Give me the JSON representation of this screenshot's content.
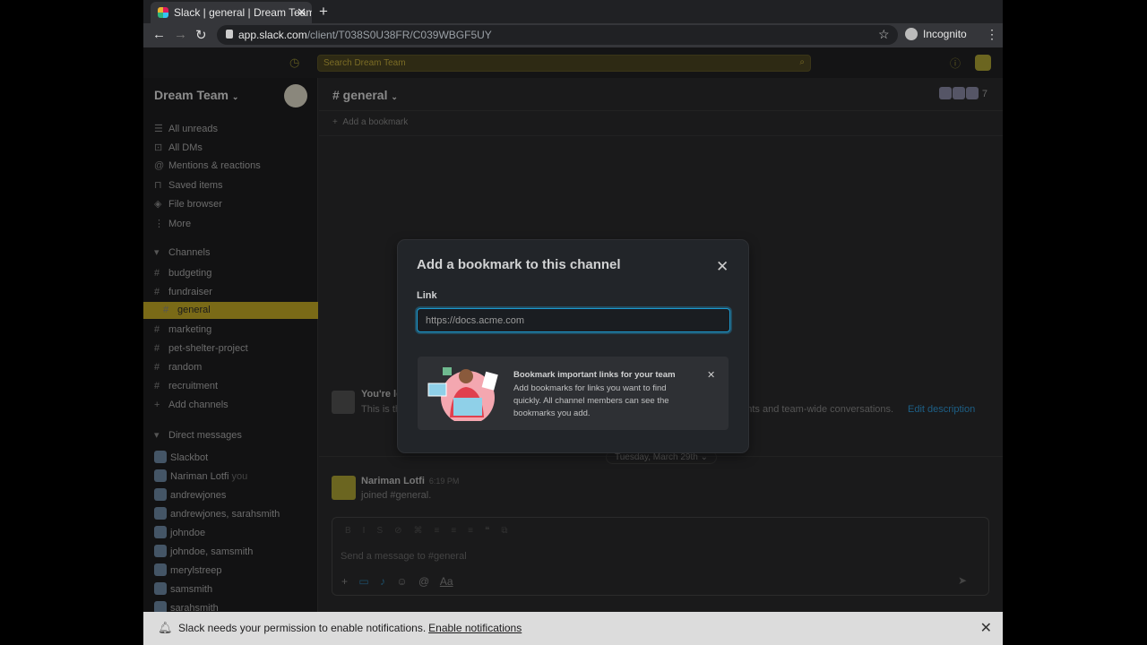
{
  "browser": {
    "tab_title": "Slack | general | Dream Team",
    "url_host": "app.slack.com",
    "url_path": "/client/T038S0U38FR/C039WBGF5UY",
    "incognito_label": "Incognito"
  },
  "search": {
    "placeholder": "Search Dream Team"
  },
  "sidebar": {
    "workspace": "Dream Team",
    "nav": [
      {
        "icon": "☰",
        "label": "All unreads"
      },
      {
        "icon": "⊡",
        "label": "All DMs"
      },
      {
        "icon": "@",
        "label": "Mentions & reactions"
      },
      {
        "icon": "⊓",
        "label": "Saved items"
      },
      {
        "icon": "◈",
        "label": "File browser"
      },
      {
        "icon": "⋮",
        "label": "More"
      }
    ],
    "channels_header": "Channels",
    "channels": [
      "budgeting",
      "fundraiser",
      "general",
      "marketing",
      "pet-shelter-project",
      "random",
      "recruitment"
    ],
    "add_channels": "Add channels",
    "dm_header": "Direct messages",
    "dms": [
      {
        "name": "Slackbot"
      },
      {
        "name": "Nariman Lotfi",
        "suffix": "you"
      },
      {
        "name": "andrewjones"
      },
      {
        "name": "andrewjones, sarahsmith"
      },
      {
        "name": "johndoe"
      },
      {
        "name": "johndoe, samsmith"
      },
      {
        "name": "merylstreep"
      },
      {
        "name": "samsmith"
      },
      {
        "name": "sarahsmith"
      }
    ]
  },
  "channel": {
    "name": "# general",
    "add_bookmark": "Add a bookmark",
    "member_count": "7",
    "intro_title": "You're lo",
    "intro_text": "This is th",
    "intro_text_tail": "nents and team-wide conversations.",
    "edit_description": "Edit description",
    "date_divider": "Tuesday, March 29th",
    "message": {
      "author": "Nariman Lotfi",
      "time": "6:19 PM",
      "text": "joined #general."
    },
    "composer_placeholder": "Send a message to #general"
  },
  "modal": {
    "title": "Add a bookmark to this channel",
    "link_label": "Link",
    "link_placeholder": "https://docs.acme.com",
    "link_value": "",
    "card_title": "Bookmark important links for your team",
    "card_body": "Add bookmarks for links you want to find quickly. All channel members can see the bookmarks you add."
  },
  "notification": {
    "text": "Slack needs your permission to enable notifications.",
    "link": "Enable notifications"
  }
}
